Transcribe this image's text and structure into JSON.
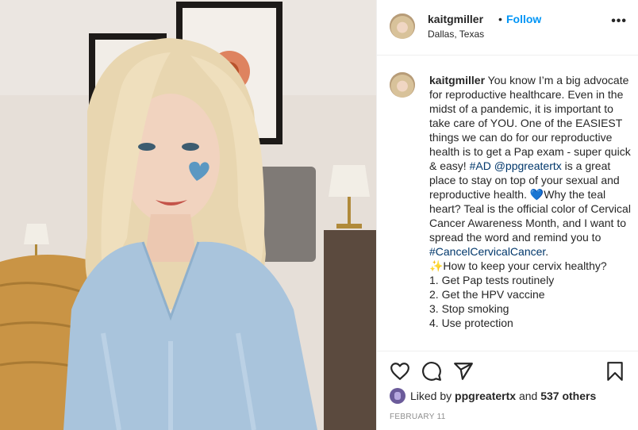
{
  "post": {
    "username": "kaitgmiller",
    "dot": "•",
    "follow_label": "Follow",
    "location": "Dallas, Texas",
    "more_label": "•••"
  },
  "caption": {
    "username": "kaitgmiller",
    "l1": "You know I’m a big advocate for reproductive healthcare. Even in the midst of a pandemic, it is important to take care of YOU. One of the EASIEST things we can do for our reproductive health is to get a Pap exam - super quick & easy! ",
    "hashtag_ad": "#AD",
    "mention": "@ppgreatertx",
    "l2": " is a great place to stay on top of your sexual and reproductive health. 💙Why the teal heart? Teal is the official color of Cervical Cancer Awareness Month, and I want to spread the word and remind you to ",
    "hashtag_ccc": "#CancelCervicalCancer",
    "l3": ".",
    "l4": "✨How to keep your cervix healthy?",
    "list": [
      "1. Get Pap tests routinely",
      "2. Get the HPV vaccine",
      "3. Stop smoking",
      "4. Use protection"
    ]
  },
  "likes": {
    "prefix": "Liked by ",
    "user": "ppgreatertx",
    "mid": " and ",
    "count": "537 others"
  },
  "date": "FEBRUARY 11",
  "icons": {
    "like": "heart-icon",
    "comment": "comment-icon",
    "share": "share-icon",
    "save": "bookmark-icon"
  }
}
